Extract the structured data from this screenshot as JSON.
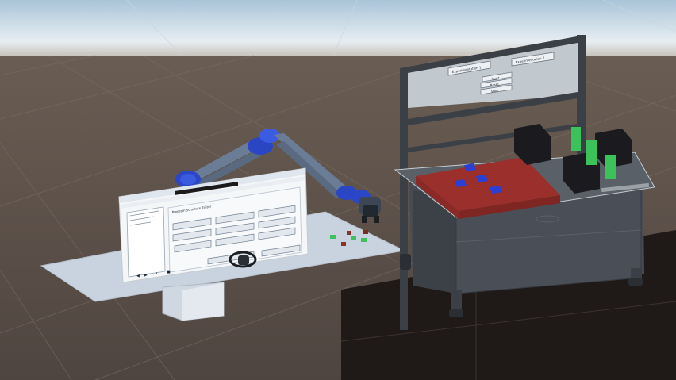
{
  "scene": {
    "sky_color": "#dbe8ef",
    "ground_color": "#5e5249",
    "floor_color": "#1f1a18"
  },
  "whiteboard": {
    "buttons": [
      {
        "label": "Experimentation 1"
      },
      {
        "label": "Experimentation 2"
      },
      {
        "label": "Start"
      },
      {
        "label": "Reset"
      },
      {
        "label": "Stop"
      }
    ]
  },
  "desktop_window": {
    "title": "Program Structure Editor",
    "nav": [
      {
        "label": "◀"
      },
      {
        "label": "▶"
      },
      {
        "label": "⏸"
      },
      {
        "label": "■"
      }
    ]
  },
  "cubes": {
    "red_tray_color": "#9b2f2b",
    "blue_color": "#2b3ed6",
    "green_color": "#3cc25a",
    "black_color": "#1b1b1f"
  }
}
